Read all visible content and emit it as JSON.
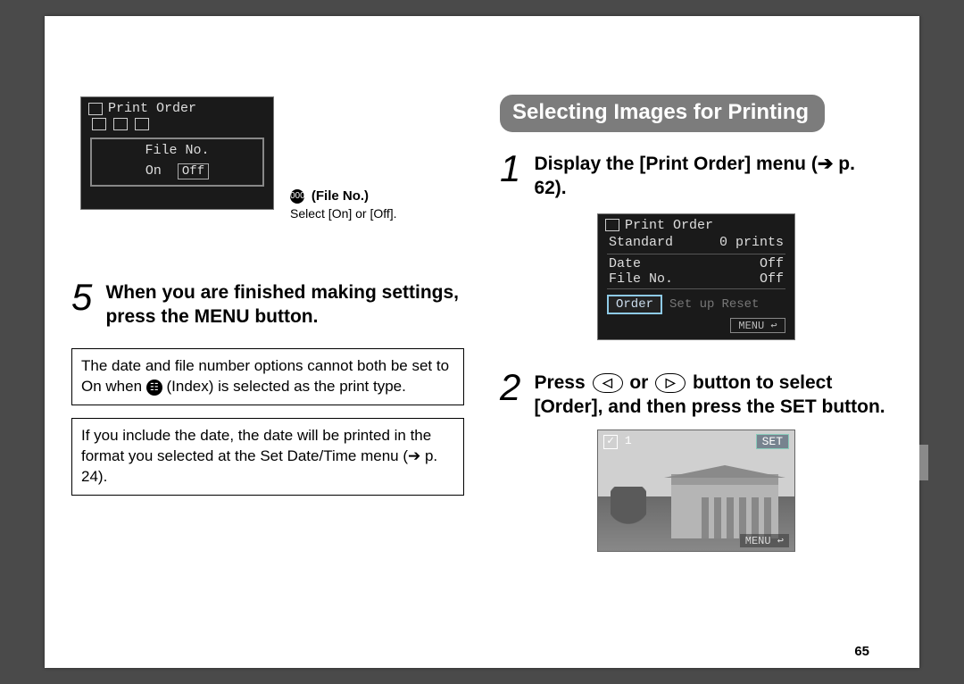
{
  "page_number": "65",
  "left": {
    "lcd1": {
      "title_icon": "print-icon",
      "title": "Print Order",
      "row_label": "File No.",
      "opt_on": "On",
      "opt_off": "Off"
    },
    "caption": {
      "icon_glyph": "000",
      "title": "(File No.)",
      "text": "Select [On] or [Off]."
    },
    "step5": {
      "num": "5",
      "text": "When you are finished making settings, press the MENU button."
    },
    "note1_a": "The date and file number options cannot both be set to On when ",
    "note1_idx": "☷",
    "note1_b": " (Index) is selected as the print type.",
    "note2": "If you include the date, the date will be printed in the format you selected at the Set Date/Time menu (➔ p. 24)."
  },
  "right": {
    "section_title": "Selecting Images for Printing",
    "step1": {
      "num": "1",
      "text_a": "Display the [Print Order] menu (",
      "arrow": "➔",
      "text_b": " p. 62)."
    },
    "lcd2": {
      "title_icon": "print-icon",
      "title": "Print Order",
      "r1a": "Standard",
      "r1b": "0 prints",
      "r2a": "Date",
      "r2b": "Off",
      "r3a": "File No.",
      "r3b": "Off",
      "btn_order": "Order",
      "btn_setup": "Set up",
      "btn_reset": "Reset",
      "tag": "MENU ↩"
    },
    "step2": {
      "num": "2",
      "a": "Press ",
      "left_glyph": "◁",
      "mid": " or ",
      "right_glyph": "▷",
      "b": " button to select [Order], and then press the SET button."
    },
    "photo": {
      "check": "✓",
      "count": "1",
      "set_label": "SET",
      "bottom": "MENU ↩"
    }
  }
}
